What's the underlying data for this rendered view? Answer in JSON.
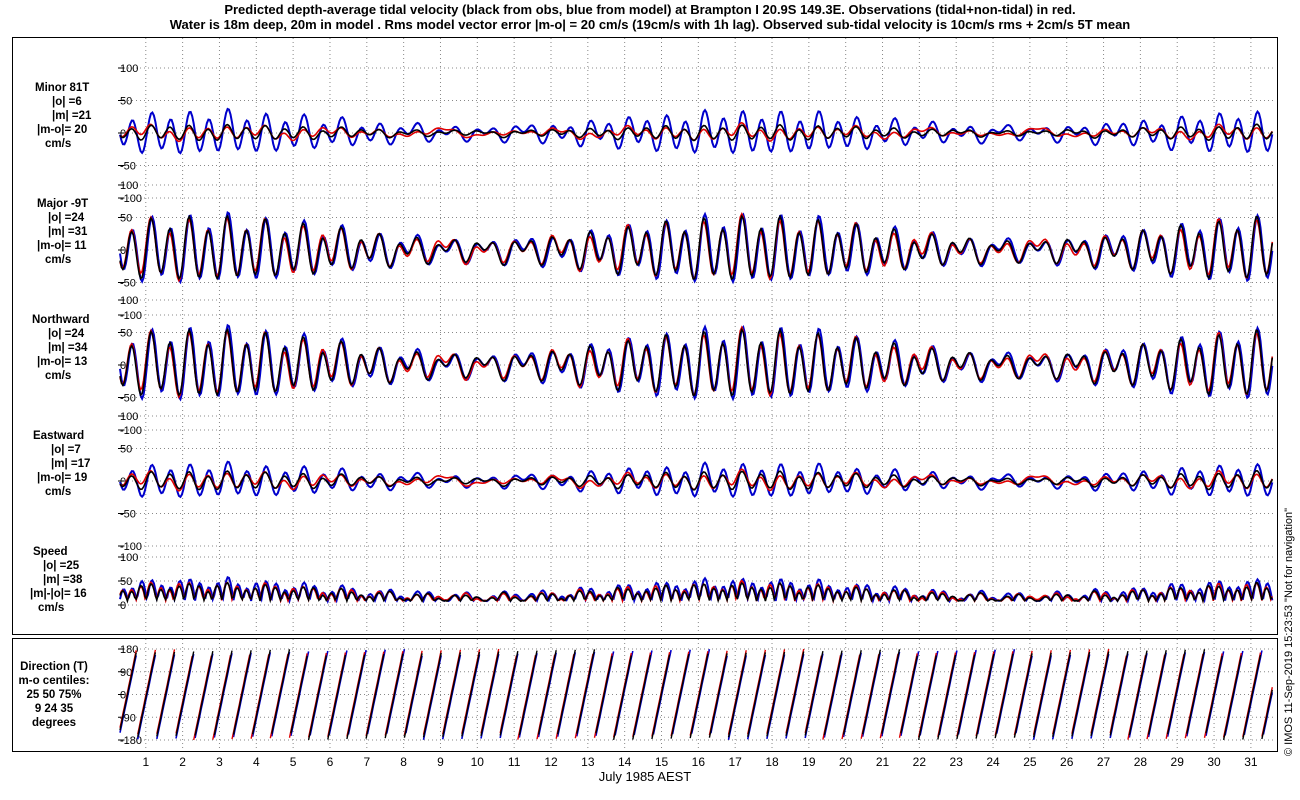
{
  "header": {
    "line1": "Predicted depth-average tidal velocity (black from obs, blue from model) at Brampton I 20.9S 149.3E. Observations (tidal+non-tidal) in red.",
    "line2": "Water is 18m deep, 20m in model . Rms model vector error |m-o| = 20 cm/s (19cm/s with 1h lag). Observed sub-tidal velocity is 10cm/s rms + 2cm/s 5T mean"
  },
  "credit": "© IMOS 11-Sep-2019 15:23:53  \"Not for navigation\"",
  "colors": {
    "observed_tidal": "#000000",
    "model": "#0000cc",
    "observations": "#e00000",
    "grid": "#888888"
  },
  "panels": [
    {
      "id": "minor",
      "labels": [
        "Minor 81T",
        "|o| =6",
        "|m| =21",
        "|m-o|= 20",
        "cm/s"
      ]
    },
    {
      "id": "major",
      "labels": [
        "Major -9T",
        "|o| =24",
        "|m| =31",
        "|m-o|= 11",
        "cm/s"
      ]
    },
    {
      "id": "northward",
      "labels": [
        "Northward",
        "|o| =24",
        "|m| =34",
        "|m-o|= 13",
        "cm/s"
      ]
    },
    {
      "id": "eastward",
      "labels": [
        "Eastward",
        "|o| =7",
        "|m| =17",
        "|m-o|= 19",
        "cm/s"
      ]
    },
    {
      "id": "speed",
      "labels": [
        "Speed",
        "|o| =25",
        "|m| =38",
        "|m|-|o|= 16",
        "cm/s"
      ]
    },
    {
      "id": "direction",
      "labels": [
        "Direction (T)",
        "m-o centiles:",
        "25  50  75%",
        "9  24  35",
        "degrees"
      ]
    }
  ],
  "chart_data": {
    "type": "line",
    "xlabel": "July 1985 AEST",
    "x_ticks": [
      "1",
      "2",
      "3",
      "4",
      "5",
      "6",
      "7",
      "8",
      "9",
      "10",
      "11",
      "12",
      "13",
      "14",
      "15",
      "16",
      "17",
      "18",
      "19",
      "20",
      "21",
      "22",
      "23",
      "24",
      "25",
      "26",
      "27",
      "28",
      "29",
      "30",
      "31"
    ],
    "series_legend": [
      "black from obs",
      "blue from model",
      "Observations (tidal+non-tidal) in red"
    ],
    "subplots": [
      {
        "name": "Minor 81T",
        "unit": "cm/s",
        "ylim": [
          -100,
          100
        ],
        "yticks": [
          "100",
          "50",
          "0",
          "-50",
          "-100"
        ],
        "rms_obs": 6,
        "rms_model": 21,
        "rms_error": 20
      },
      {
        "name": "Major -9T",
        "unit": "cm/s",
        "ylim": [
          -100,
          100
        ],
        "yticks": [
          "100",
          "50",
          "0",
          "-50",
          "-100"
        ],
        "rms_obs": 24,
        "rms_model": 31,
        "rms_error": 11
      },
      {
        "name": "Northward",
        "unit": "cm/s",
        "ylim": [
          -100,
          100
        ],
        "yticks": [
          "100",
          "50",
          "0",
          "-50",
          "-100"
        ],
        "rms_obs": 24,
        "rms_model": 34,
        "rms_error": 13
      },
      {
        "name": "Eastward",
        "unit": "cm/s",
        "ylim": [
          -100,
          100
        ],
        "yticks": [
          "100",
          "50",
          "0",
          "-50",
          "-100"
        ],
        "rms_obs": 7,
        "rms_model": 17,
        "rms_error": 19
      },
      {
        "name": "Speed",
        "unit": "cm/s",
        "ylim": [
          0,
          100
        ],
        "yticks": [
          "100",
          "50",
          "0"
        ],
        "rms_obs": 25,
        "rms_model": 38,
        "rms_error": 16
      },
      {
        "name": "Direction (T)",
        "unit": "degrees",
        "ylim": [
          -180,
          180
        ],
        "yticks": [
          "180",
          "90",
          "0",
          "-90",
          "-180"
        ],
        "centiles": [
          9,
          24,
          35
        ]
      }
    ]
  }
}
